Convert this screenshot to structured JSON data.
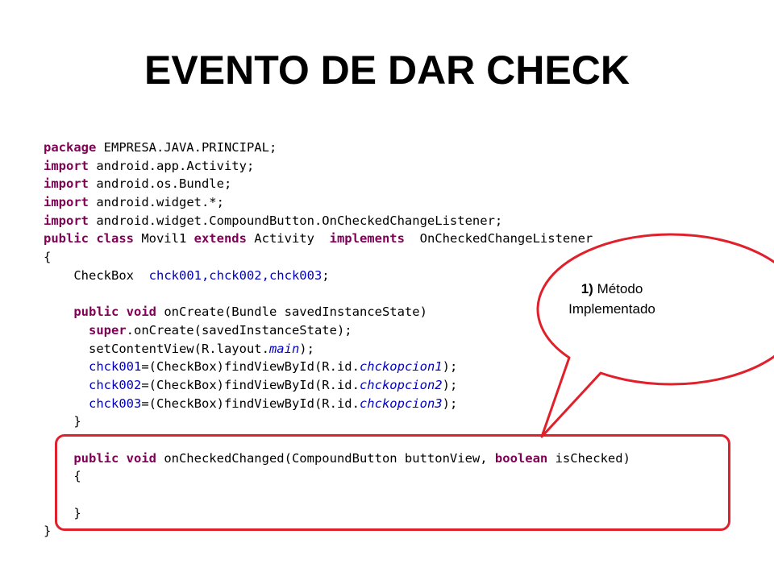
{
  "slide": {
    "title": "EVENTO DE DAR CHECK"
  },
  "code": {
    "l1_kw": "package",
    "l1_rest": " EMPRESA.JAVA.PRINCIPAL;",
    "l2_kw": "import",
    "l2_rest": " android.app.Activity;",
    "l3_kw": "import",
    "l3_rest": " android.os.Bundle;",
    "l4_kw": "import",
    "l4_rest": " android.widget.*;",
    "l5_kw": "import",
    "l5_rest": " android.widget.CompoundButton.OnCheckedChangeListener;",
    "l6_kw1": "public class",
    "l6_mid1": " Movil1 ",
    "l6_kw2": "extends",
    "l6_mid2": " Activity  ",
    "l6_kw3": "implements",
    "l6_rest": "  OnCheckedChangeListener",
    "l7": "{",
    "l8_type": "    CheckBox  ",
    "l8_fields": "chck001,chck002,chck003",
    "l8_end": ";",
    "l9": "",
    "l10_kw": "    public void",
    "l10_rest": " onCreate(Bundle savedInstanceState)",
    "l11_kw": "      super",
    "l11_rest": ".onCreate(savedInstanceState);",
    "l12_pre": "      setContentView(R.layout.",
    "l12_it": "main",
    "l12_end": ");",
    "l13_f": "      chck001",
    "l13_mid": "=(CheckBox)findViewById(R.id.",
    "l13_it": "chckopcion1",
    "l13_end": ");",
    "l14_f": "      chck002",
    "l14_mid": "=(CheckBox)findViewById(R.id.",
    "l14_it": "chckopcion2",
    "l14_end": ");",
    "l15_f": "      chck003",
    "l15_mid": "=(CheckBox)findViewById(R.id.",
    "l15_it": "chckopcion3",
    "l15_end": ");",
    "l16": "    }",
    "l17": "",
    "l18_kw": "    public void",
    "l18_mid": " onCheckedChanged(CompoundButton buttonView, ",
    "l18_kw2": "boolean",
    "l18_end": " isChecked)",
    "l19": "    {",
    "l20": "",
    "l21": "    }",
    "l22": "}"
  },
  "callout": {
    "number": "1)",
    "line1": " Método",
    "line2": "Implementado"
  },
  "colors": {
    "accent_red": "#e0202a",
    "keyword": "#7f0055",
    "field": "#0000c0"
  }
}
